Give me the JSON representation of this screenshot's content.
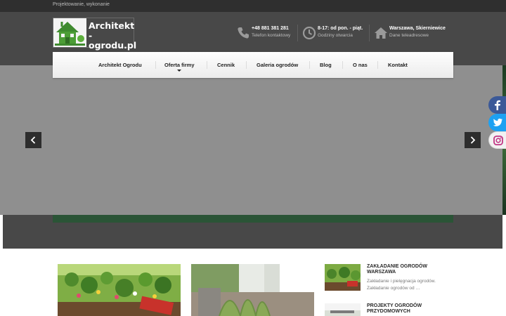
{
  "topbar": {
    "tagline": "Projektowanie, wykonanie"
  },
  "logo": {
    "line1": "Architekt",
    "line2": "-ogrodu.pl"
  },
  "contacts": [
    {
      "icon": "phone-icon",
      "title": "+48 881 381 281",
      "subtitle": "Telefon kontaktowy"
    },
    {
      "icon": "clock-icon",
      "title": "8-17: od pon. - piąt.",
      "subtitle": "Godziny otwarcia"
    },
    {
      "icon": "home-icon",
      "title": "Warszawa, Skierniewice",
      "subtitle": "Dane teleadresowe"
    }
  ],
  "nav": {
    "items": [
      "Architekt Ogrodu",
      "Oferta firmy",
      "Cennik",
      "Galeria ogrodów",
      "Blog",
      "O nas",
      "Kontakt"
    ]
  },
  "social": [
    "facebook-icon",
    "twitter-icon",
    "instagram-icon"
  ],
  "colors": {
    "header": "#484848",
    "topbar": "#2f2f2f",
    "accent_green": "#2a5436",
    "facebook": "#3b5998",
    "twitter": "#1da1f2"
  },
  "sidebar_posts": [
    {
      "title": "ZAKŁADANIE OGRODÓW WARSZAWA",
      "excerpt": "Zakładanie i pielęgnacja ogrodów. Zakładanie ogrodów od …"
    },
    {
      "title": "PROJEKTY OGRODÓW PRZYDOMOWYCH",
      "excerpt": ""
    }
  ]
}
